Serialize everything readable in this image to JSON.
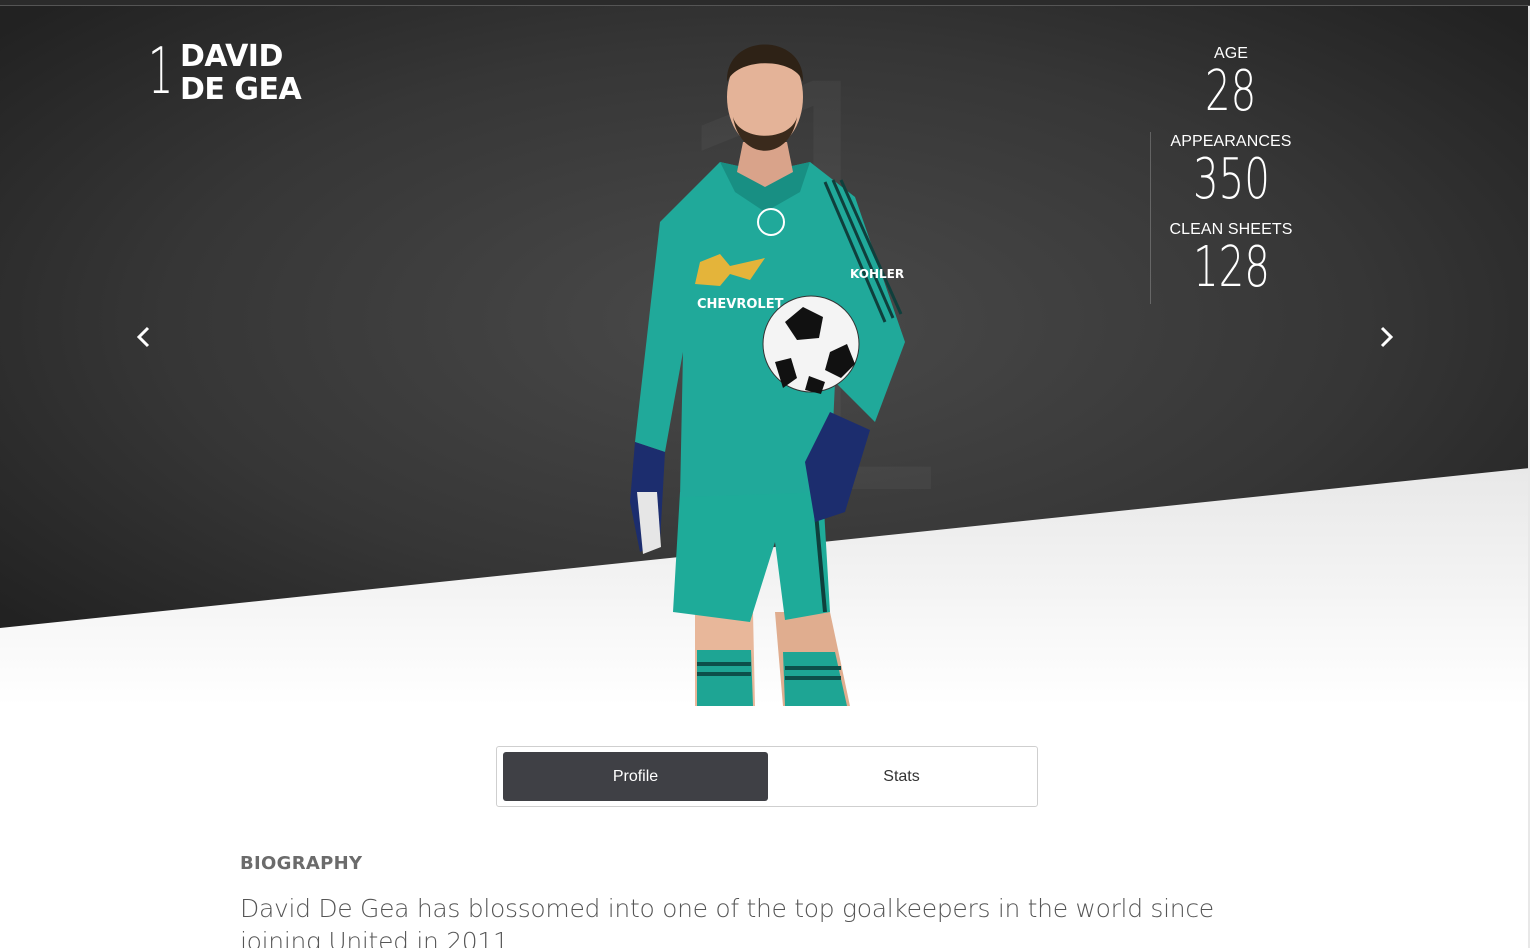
{
  "player": {
    "number": "1",
    "first_name": "DAVID",
    "last_name": "DE GEA",
    "kit_sponsor": "CHEVROLET",
    "sleeve_sponsor": "KOHLER"
  },
  "stats": [
    {
      "label": "AGE",
      "value": "28"
    },
    {
      "label": "APPEARANCES",
      "value": "350"
    },
    {
      "label": "CLEAN SHEETS",
      "value": "128"
    }
  ],
  "nav": {
    "prev_icon": "chevron-left-icon",
    "next_icon": "chevron-right-icon"
  },
  "tabs": [
    {
      "label": "Profile",
      "active": true
    },
    {
      "label": "Stats",
      "active": false
    }
  ],
  "biography": {
    "heading": "BIOGRAPHY",
    "text": "David De Gea has blossomed into one of the top goalkeepers in the world since joining United in 2011"
  },
  "colors": {
    "hero_dark": "#2f2f2f",
    "kit_teal": "#1fa898",
    "active_tab": "#3f4045"
  }
}
